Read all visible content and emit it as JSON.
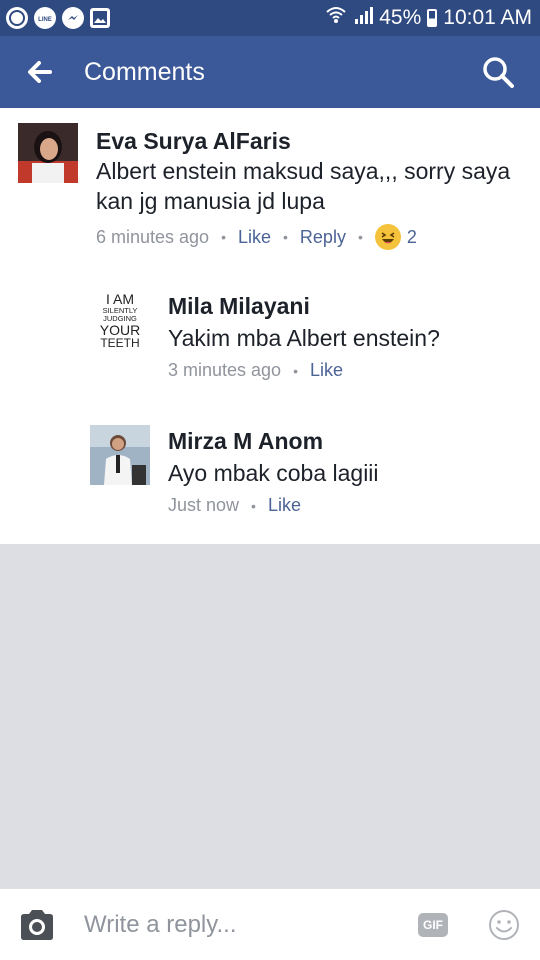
{
  "status_bar": {
    "battery": "45%",
    "time": "10:01 AM",
    "left_icons": [
      "whatsapp-icon",
      "line-icon",
      "messenger-icon",
      "gallery-icon"
    ]
  },
  "header": {
    "title": "Comments"
  },
  "comments": [
    {
      "name": "Eva Surya AlFaris",
      "text": "Albert enstein maksud saya,,, sorry saya kan jg manusia jd lupa",
      "time": "6 minutes ago",
      "like": "Like",
      "reply": "Reply",
      "reaction_count": "2"
    },
    {
      "name": "Mila Milayani",
      "text": "Yakim mba Albert enstein?",
      "time": "3 minutes ago",
      "like": "Like",
      "avatar_text": [
        "I AM",
        "SILENTLY",
        "JUDGING",
        "YOUR",
        "TEETH"
      ]
    },
    {
      "name": "Mirza M Anom",
      "text": "Ayo mbak coba lagiii",
      "time": "Just now",
      "like": "Like"
    }
  ],
  "reply_bar": {
    "placeholder": "Write a reply...",
    "gif_label": "GIF"
  },
  "colors": {
    "status_bar": "#2f4a80",
    "header": "#3b5998",
    "link": "#4b6395",
    "meta": "#90949c",
    "background": "#dcdee3"
  }
}
